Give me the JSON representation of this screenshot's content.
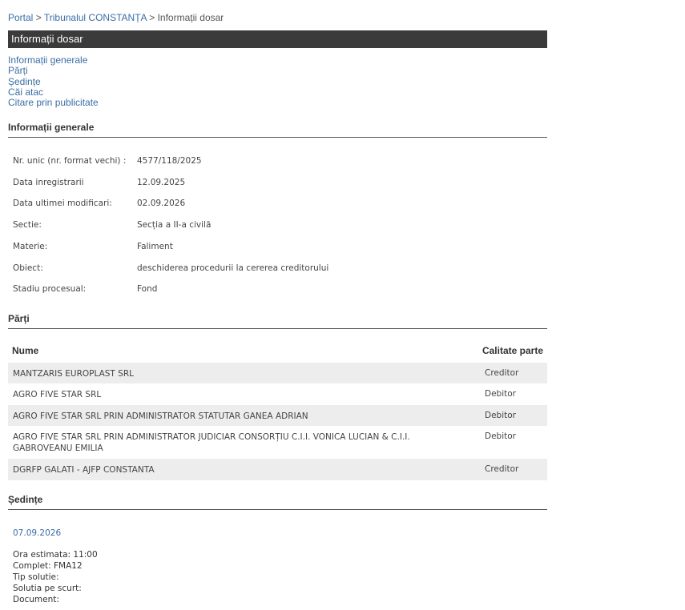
{
  "breadcrumb": {
    "items": [
      "Portal",
      "Tribunalul CONSTANȚA",
      "Informații dosar"
    ],
    "separator": ">"
  },
  "page_title": "Informații dosar",
  "toc": [
    "Informații generale",
    "Părți",
    "Ședințe",
    "Căi atac",
    "Citare prin publicitate"
  ],
  "general": {
    "heading": "Informații generale",
    "rows": [
      {
        "label": "Nr. unic (nr. format vechi) :",
        "value": "4577/118/2025"
      },
      {
        "label": "Data inregistrarii",
        "value": "12.09.2025"
      },
      {
        "label": "Data ultimei modificari:",
        "value": "02.09.2026"
      },
      {
        "label": "Sectie:",
        "value": "Secția a II-a civilă"
      },
      {
        "label": "Materie:",
        "value": "Faliment"
      },
      {
        "label": "Obiect:",
        "value": "deschiderea procedurii la cererea creditorului"
      },
      {
        "label": "Stadiu procesual:",
        "value": "Fond"
      }
    ]
  },
  "parti": {
    "heading": "Părți",
    "columns": [
      "Nume",
      "Calitate parte"
    ],
    "rows": [
      {
        "nume": "MANTZARIS EUROPLAST SRL",
        "calitate": "Creditor"
      },
      {
        "nume": "AGRO FIVE STAR SRL",
        "calitate": "Debitor"
      },
      {
        "nume": "AGRO FIVE STAR SRL PRIN ADMINISTRATOR STATUTAR GANEA ADRIAN",
        "calitate": "Debitor"
      },
      {
        "nume": "AGRO FIVE STAR SRL PRIN ADMINISTRATOR JUDICIAR CONSORȚIU C.I.I. VONICA LUCIAN & C.I.I. GABROVEANU EMILIA",
        "calitate": "Debitor"
      },
      {
        "nume": "DGRFP GALATI - AJFP CONSTANTA",
        "calitate": "Creditor"
      }
    ]
  },
  "sedinte": {
    "heading": "Ședințe",
    "date": "07.09.2026",
    "details": [
      "Ora estimata: 11:00",
      "Complet: FMA12",
      "Tip solutie:",
      "Solutia pe scurt:",
      "Document:"
    ]
  }
}
